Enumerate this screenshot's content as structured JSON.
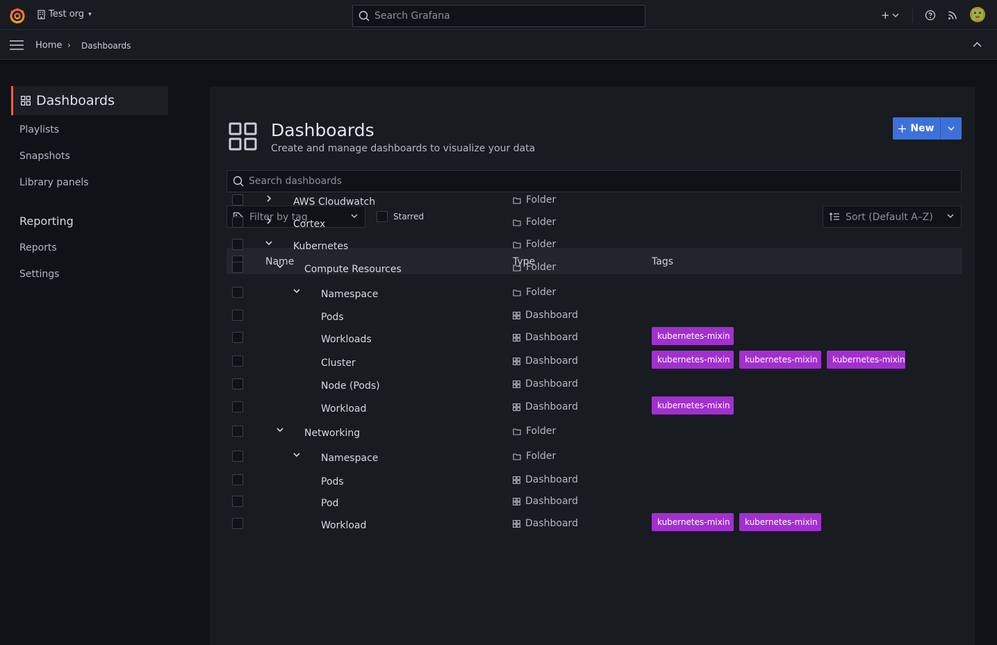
{
  "topbar": {
    "org_name": "Test org",
    "search_placeholder": "Search Grafana",
    "plus_label": "+"
  },
  "breadcrumb": {
    "home": "Home",
    "separator": "›",
    "current": "Dashboards"
  },
  "sidenav": {
    "active": "Dashboards",
    "items": [
      "Playlists",
      "Snapshots",
      "Library panels"
    ],
    "section": "Reporting",
    "section_items": [
      "Reports",
      "Settings"
    ]
  },
  "page": {
    "title": "Dashboards",
    "subtitle": "Create and manage dashboards to visualize your data",
    "new_label": "New",
    "search_placeholder": "Search dashboards",
    "tag_filter_placeholder": "Filter by tag",
    "starred_label": "Starred",
    "sort_placeholder": "Sort (Default A–Z)"
  },
  "table": {
    "columns": [
      "Name",
      "Type",
      "Tags"
    ],
    "rows": [
      {
        "name": "AWS Cloudwatch",
        "type": "Folder",
        "tags": [],
        "expanded": false
      },
      {
        "name": "Cortex",
        "type": "Folder",
        "tags": [],
        "expanded": false
      },
      {
        "name": "Kubernetes",
        "type": "Folder",
        "tags": [],
        "expanded": true
      },
      {
        "name": "Compute Resources",
        "type": "Folder",
        "tags": [],
        "expanded": true
      },
      {
        "name": "Namespace",
        "type": "Folder",
        "tags": [],
        "expanded": true
      },
      {
        "name": "Pods",
        "type": "Dashboard",
        "tags": []
      },
      {
        "name": "Workloads",
        "type": "Dashboard",
        "tags": [
          "kubernetes-mixin"
        ]
      },
      {
        "name": "Cluster",
        "type": "Dashboard",
        "tags": [
          "kubernetes-mixin",
          "kubernetes-mixin",
          "kubernetes-mixin"
        ]
      },
      {
        "name": "Node (Pods)",
        "type": "Dashboard",
        "tags": []
      },
      {
        "name": "Workload",
        "type": "Dashboard",
        "tags": [
          "kubernetes-mixin"
        ]
      },
      {
        "name": "Networking",
        "type": "Folder",
        "tags": [],
        "expanded": true
      },
      {
        "name": "Namespace",
        "type": "Folder",
        "tags": [],
        "expanded": true
      },
      {
        "name": "Pods",
        "type": "Dashboard",
        "tags": []
      },
      {
        "name": "Pod",
        "type": "Dashboard",
        "tags": []
      },
      {
        "name": "Workload",
        "type": "Dashboard",
        "tags": [
          "kubernetes-mixin",
          "kubernetes-mixin"
        ]
      }
    ]
  },
  "colors": {
    "accent": "#3d71d9",
    "tag": "#a22fd0",
    "active_indicator": "#f55f3e"
  }
}
